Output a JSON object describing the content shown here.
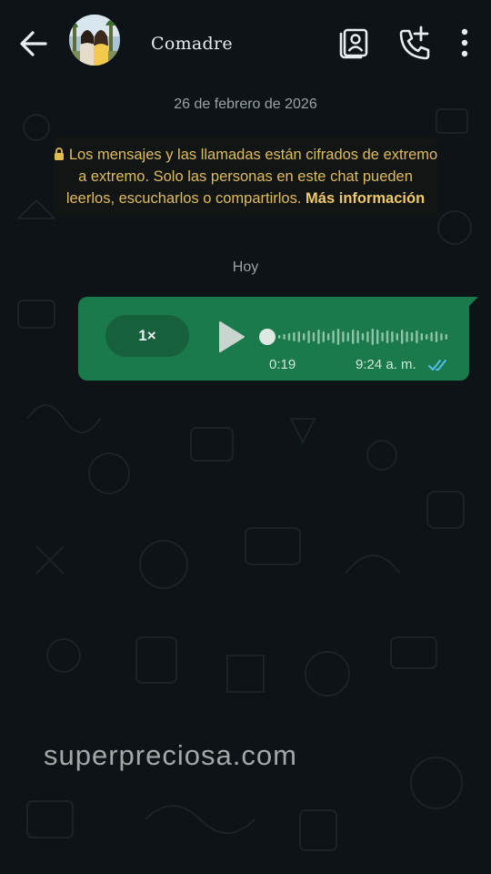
{
  "header": {
    "contact_name": "Comadre",
    "back_icon": "arrow-left-icon",
    "avatar_icon": "contact-avatar",
    "contact_card_icon": "contact-card-icon",
    "add_call_icon": "add-call-icon",
    "menu_icon": "more-vert-icon"
  },
  "chat": {
    "date_label": "26 de febrero de 2026",
    "encryption_notice": "Los mensajes y las llamadas están cifrados de extremo a extremo. Solo las personas en este chat pueden leerlos, escucharlos o compartirlos.",
    "encryption_more": "Más información",
    "day_label": "Hoy"
  },
  "voice_message": {
    "speed_label": "1×",
    "duration": "0:19",
    "time": "9:24 a. m.",
    "progress": 0,
    "status": "read"
  },
  "watermark": "superpreciosa.com",
  "colors": {
    "background": "#0d1316",
    "bubble": "#1b7a4c",
    "notice_text": "#e0bb5a",
    "read_ticks": "#53bdeb"
  }
}
